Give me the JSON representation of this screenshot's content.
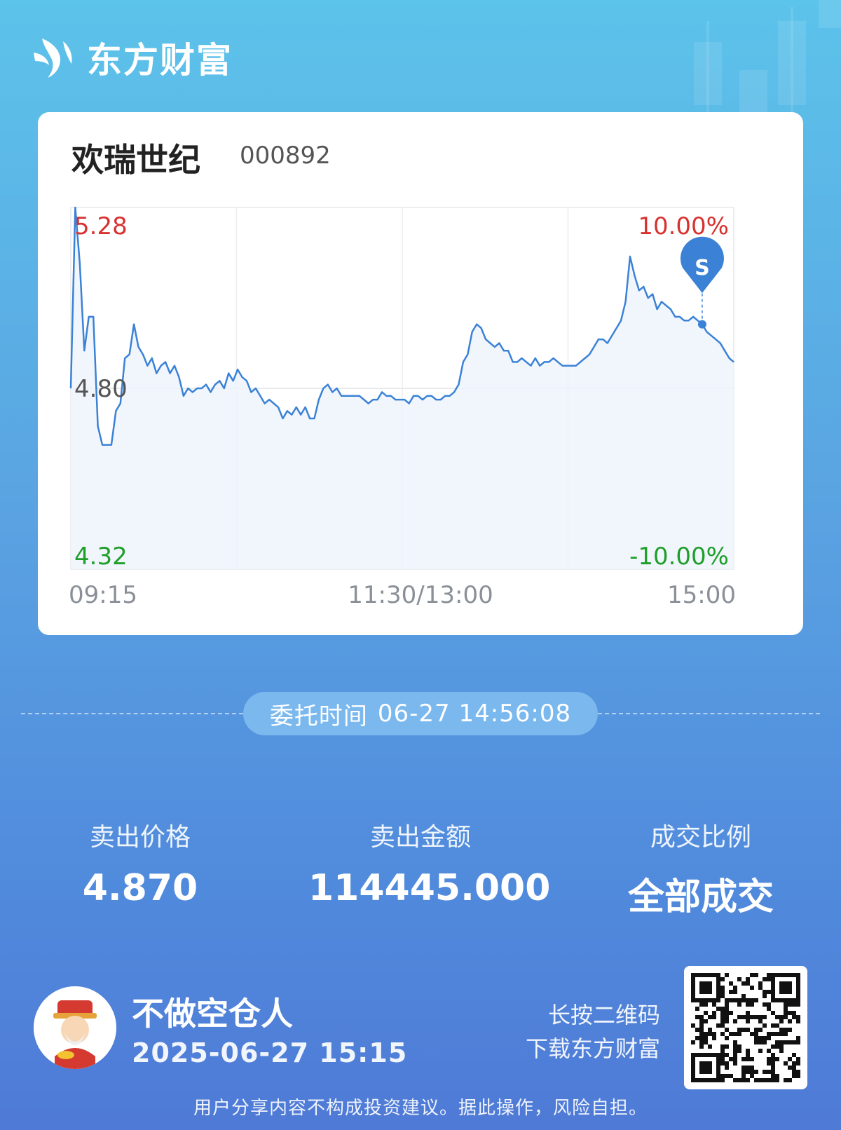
{
  "brand": {
    "name": "东方财富"
  },
  "stock": {
    "name": "欢瑞世纪",
    "code": "000892"
  },
  "chart_data": {
    "type": "line",
    "y_left_ticks": [
      "5.28",
      "4.80",
      "4.32"
    ],
    "y_right_ticks": [
      "10.00%",
      "-10.00%"
    ],
    "x_ticks": [
      "09:15",
      "11:30/13:00",
      "15:00"
    ],
    "ylim": [
      4.32,
      5.28
    ],
    "prev_close": 4.8,
    "marker_label": "S",
    "up_color": "#d7322f",
    "down_color": "#1f9e2a",
    "line_color": "#3b82d6",
    "values": [
      4.8,
      5.28,
      5.13,
      4.9,
      4.99,
      4.99,
      4.7,
      4.65,
      4.65,
      4.65,
      4.74,
      4.76,
      4.88,
      4.89,
      4.97,
      4.91,
      4.89,
      4.86,
      4.88,
      4.84,
      4.86,
      4.87,
      4.84,
      4.86,
      4.83,
      4.78,
      4.8,
      4.79,
      4.8,
      4.8,
      4.81,
      4.79,
      4.81,
      4.82,
      4.8,
      4.84,
      4.82,
      4.85,
      4.83,
      4.82,
      4.79,
      4.8,
      4.78,
      4.76,
      4.77,
      4.76,
      4.75,
      4.72,
      4.74,
      4.73,
      4.75,
      4.73,
      4.75,
      4.72,
      4.72,
      4.77,
      4.8,
      4.81,
      4.79,
      4.8,
      4.78,
      4.78,
      4.78,
      4.78,
      4.78,
      4.77,
      4.76,
      4.77,
      4.77,
      4.79,
      4.78,
      4.78,
      4.77,
      4.77,
      4.77,
      4.76,
      4.78,
      4.78,
      4.77,
      4.78,
      4.78,
      4.77,
      4.77,
      4.78,
      4.78,
      4.79,
      4.81,
      4.87,
      4.89,
      4.95,
      4.97,
      4.96,
      4.93,
      4.92,
      4.91,
      4.92,
      4.9,
      4.9,
      4.87,
      4.87,
      4.88,
      4.87,
      4.86,
      4.88,
      4.86,
      4.87,
      4.87,
      4.88,
      4.87,
      4.86,
      4.86,
      4.86,
      4.86,
      4.87,
      4.88,
      4.89,
      4.91,
      4.93,
      4.93,
      4.92,
      4.94,
      4.96,
      4.98,
      5.03,
      5.15,
      5.1,
      5.06,
      5.07,
      5.04,
      5.05,
      5.01,
      5.03,
      5.02,
      5.01,
      4.99,
      4.99,
      4.98,
      4.98,
      4.99,
      4.98,
      4.97,
      4.95,
      4.94,
      4.93,
      4.92,
      4.9,
      4.88,
      4.87
    ]
  },
  "order": {
    "label": "委托时间",
    "time": "06-27 14:56:08"
  },
  "stats": {
    "price_label": "卖出价格",
    "price_value": "4.870",
    "amount_label": "卖出金额",
    "amount_value": "114445.000",
    "fill_label": "成交比例",
    "fill_value": "全部成交"
  },
  "user": {
    "name": "不做空仓人",
    "share_time": "2025-06-27 15:15"
  },
  "qr_hint": {
    "line1": "长按二维码",
    "line2": "下载东方财富"
  },
  "disclaimer": "用户分享内容不构成投资建议。据此操作，风险自担。"
}
